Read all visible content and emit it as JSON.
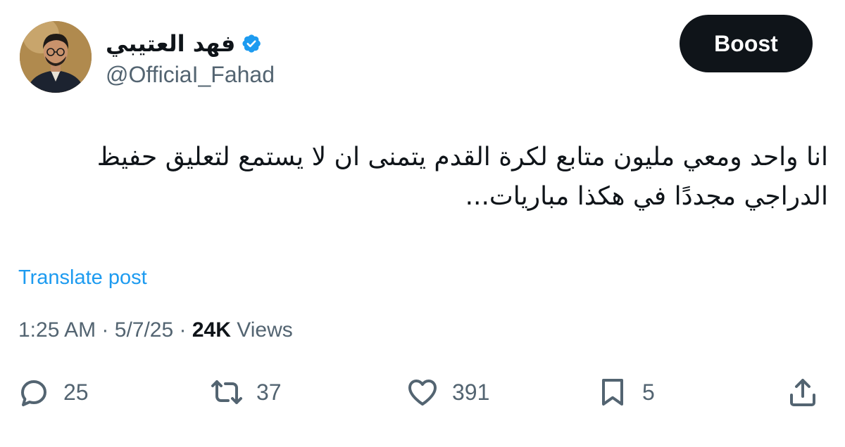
{
  "author": {
    "display_name": "فهد العتيبي",
    "handle": "@OfficiaI_Fahad",
    "verified": true
  },
  "boost_label": "Boost",
  "tweet": {
    "text": "انا واحد ومعي مليون متابع لكرة القدم يتمنى ان لا يستمع لتعليق حفيظ الدراجي مجددًا في هكذا مباريات..."
  },
  "translate_label": "Translate post",
  "meta": {
    "time": "1:25 AM",
    "separator": "·",
    "date": "5/7/25",
    "views_count": "24K",
    "views_label": "Views"
  },
  "actions": {
    "replies": "25",
    "reposts": "37",
    "likes": "391",
    "bookmarks": "5"
  },
  "colors": {
    "text_primary": "#0f1419",
    "text_secondary": "#536471",
    "accent": "#1d9bf0",
    "boost_bg": "#0f1419"
  }
}
